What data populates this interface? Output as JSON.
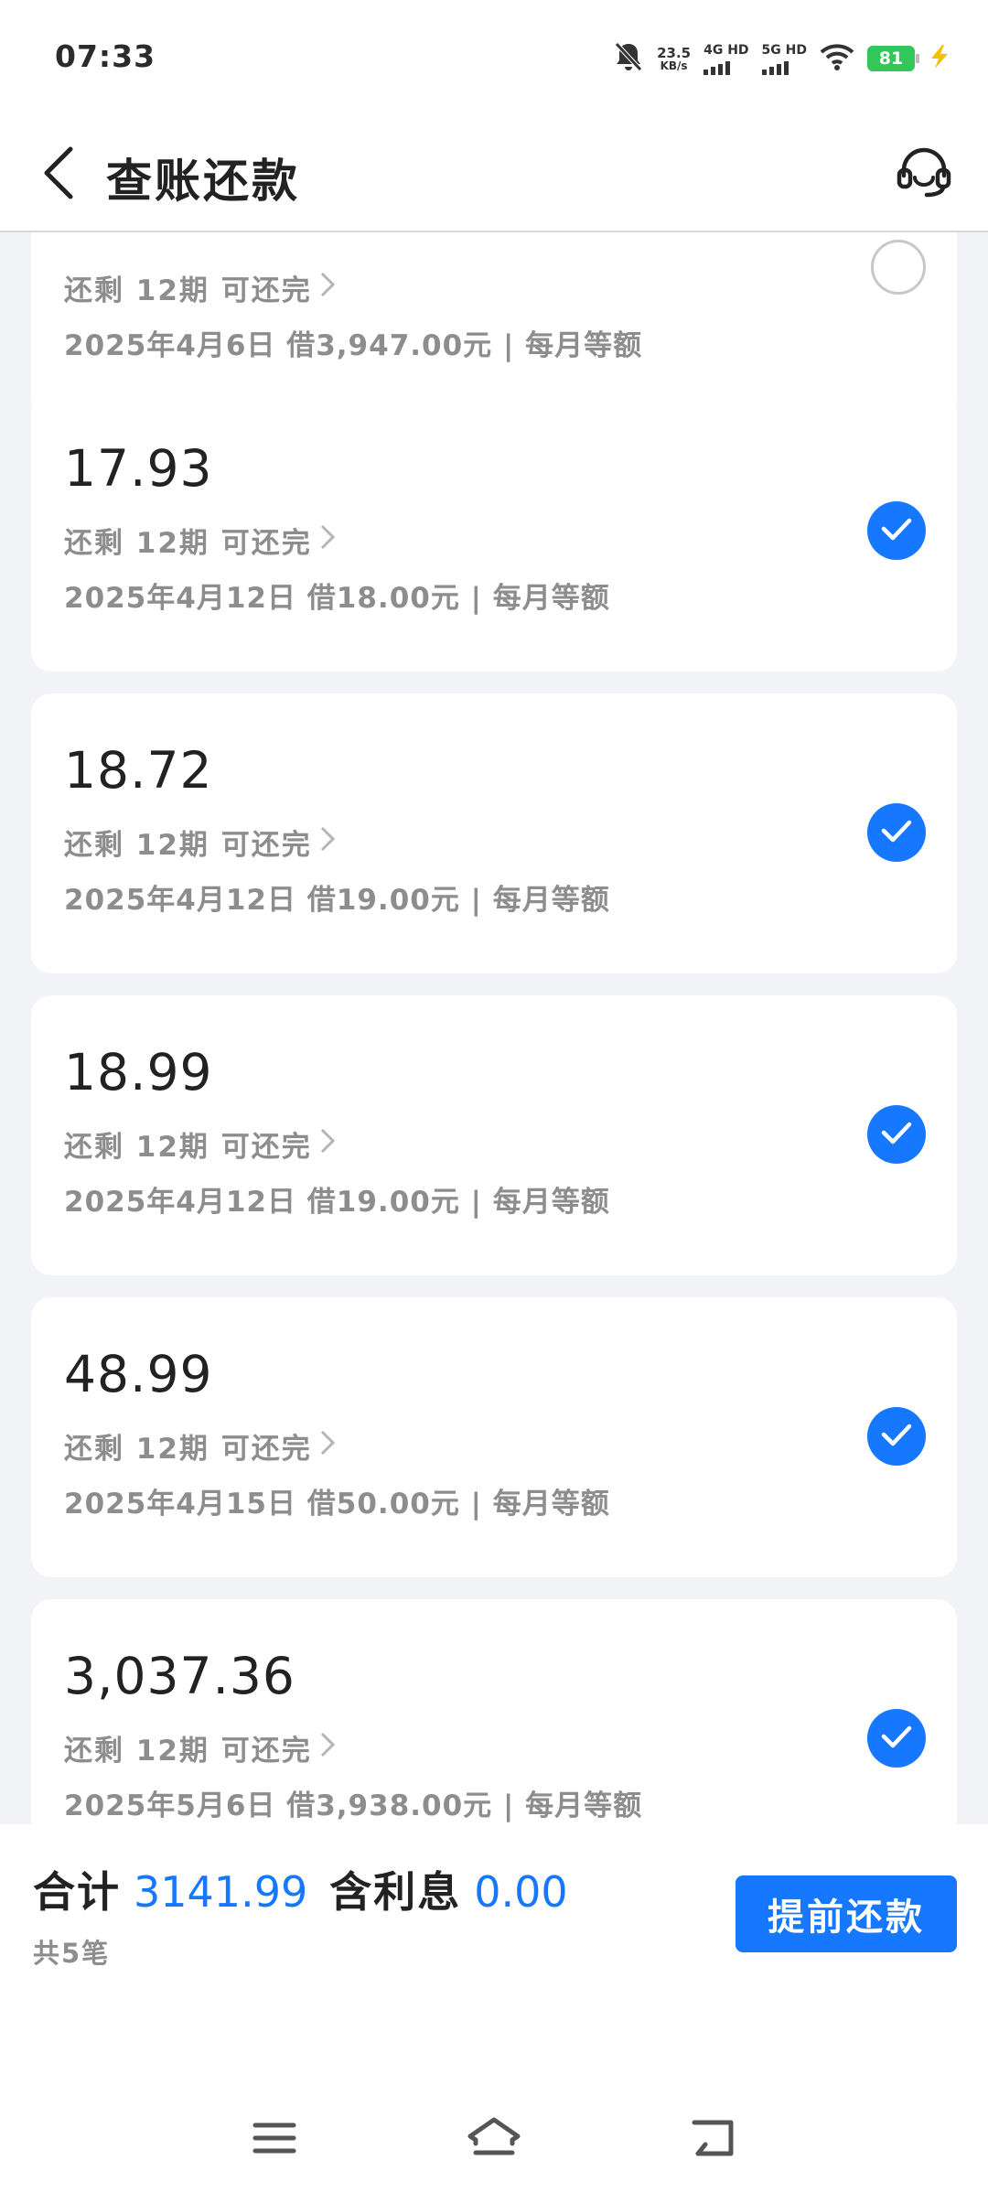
{
  "status_bar": {
    "time": "07:33",
    "net_speed_value": "23.5",
    "net_speed_unit": "KB/s",
    "sim1_label": "4G HD",
    "sim2_label": "5G HD",
    "battery": "81",
    "icons": [
      "bell-muted-icon",
      "signal-icon",
      "wifi-icon",
      "battery-icon",
      "charging-icon"
    ]
  },
  "header": {
    "title": "查账还款",
    "icons": [
      "back-arrow-icon",
      "customer-service-icon"
    ]
  },
  "loans": [
    {
      "amount": "",
      "remaining": "还剩 12期 可还完",
      "info": "2025年4月6日 借3,947.00元 | 每月等额",
      "checked": false
    },
    {
      "amount": "17.93",
      "remaining": "还剩 12期 可还完",
      "info": "2025年4月12日 借18.00元 | 每月等额",
      "checked": true
    },
    {
      "amount": "18.72",
      "remaining": "还剩 12期 可还完",
      "info": "2025年4月12日 借19.00元 | 每月等额",
      "checked": true
    },
    {
      "amount": "18.99",
      "remaining": "还剩 12期 可还完",
      "info": "2025年4月12日 借19.00元 | 每月等额",
      "checked": true
    },
    {
      "amount": "48.99",
      "remaining": "还剩 12期 可还完",
      "info": "2025年4月15日 借50.00元 | 每月等额",
      "checked": true
    },
    {
      "amount": "3,037.36",
      "remaining": "还剩 12期 可还完",
      "info": "2025年5月6日 借3,938.00元 | 每月等额",
      "checked": true
    }
  ],
  "summary": {
    "total_label": "合计",
    "total_value": "3141.99",
    "interest_label": "含利息",
    "interest_value": "0.00",
    "count": "共5笔",
    "button": "提前还款"
  },
  "colors": {
    "accent": "#1677ff",
    "background": "#f1f3f6",
    "secondary_text": "#8d8d8d"
  },
  "nav": {
    "icons": [
      "menu-icon",
      "home-icon",
      "back-icon"
    ]
  }
}
